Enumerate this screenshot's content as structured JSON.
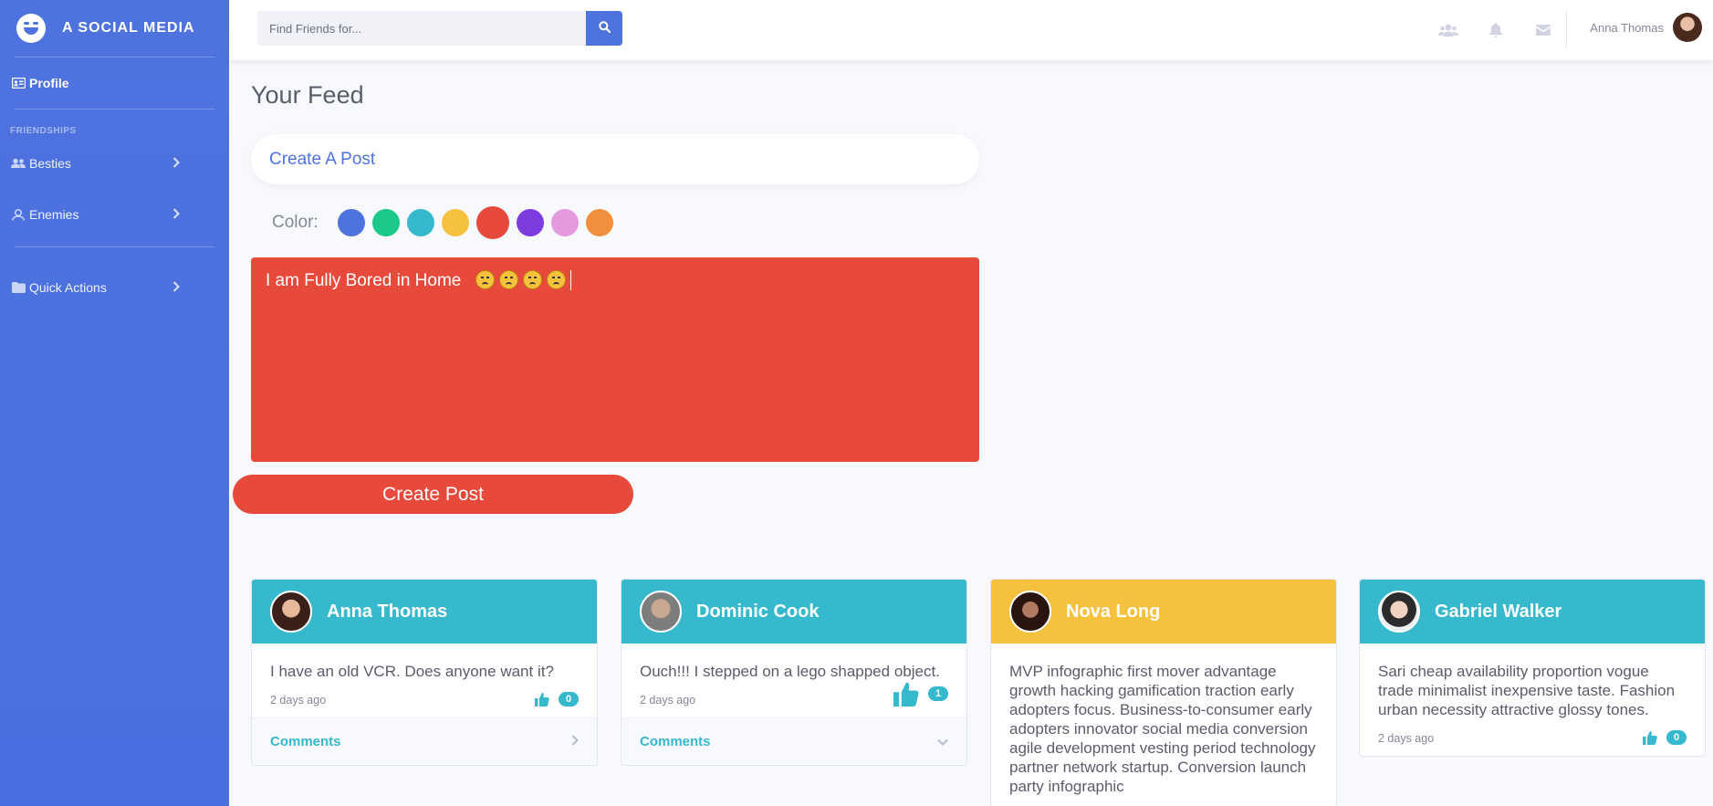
{
  "brand": {
    "name": "A SOCIAL MEDIA"
  },
  "sidebar": {
    "profile_label": "Profile",
    "heading": "FRIENDSHIPS",
    "items": [
      {
        "label": "Besties",
        "icon": "users-icon"
      },
      {
        "label": "Enemies",
        "icon": "user-skull-icon"
      },
      {
        "label": "Quick Actions",
        "icon": "folder-icon"
      }
    ]
  },
  "topbar": {
    "search_placeholder": "Find Friends for...",
    "user_name": "Anna Thomas",
    "icons": [
      "friends-icon",
      "bell-icon",
      "envelope-icon"
    ]
  },
  "main": {
    "title": "Your Feed",
    "create_title": "Create A Post",
    "color_label": "Color:",
    "colors": [
      "#4e73df",
      "#1cc88a",
      "#36b9cc",
      "#f6c23e",
      "#e74a3b",
      "#7e3be0",
      "#e59ae0",
      "#f18f3f"
    ],
    "selected_color": "#e74a3b",
    "post_text": "I am Fully Bored in Home",
    "post_emoji_count": 4,
    "create_button": "Create Post"
  },
  "posts": [
    {
      "name": "Anna Thomas",
      "header_color": "#36b9cc",
      "text": "I have an old VCR. Does anyone want it?",
      "time": "2 days ago",
      "likes": "0",
      "comments_label": "Comments"
    },
    {
      "name": "Dominic Cook",
      "header_color": "#36b9cc",
      "text": "Ouch!!! I stepped on a lego shapped object.",
      "time": "2 days ago",
      "likes": "1",
      "comments_label": "Comments"
    },
    {
      "name": "Nova Long",
      "header_color": "#f6c23e",
      "text": "MVP infographic first mover advantage growth hacking gamification traction early adopters focus. Business-to-consumer early adopters innovator social media conversion agile development vesting period technology partner network startup. Conversion launch party infographic",
      "time": "",
      "likes": "",
      "comments_label": ""
    },
    {
      "name": "Gabriel Walker",
      "header_color": "#36b9cc",
      "text": "Sari cheap availability proportion vogue trade minimalist inexpensive taste. Fashion urban necessity attractive glossy tones.",
      "time": "2 days ago",
      "likes": "0",
      "comments_label": ""
    }
  ]
}
